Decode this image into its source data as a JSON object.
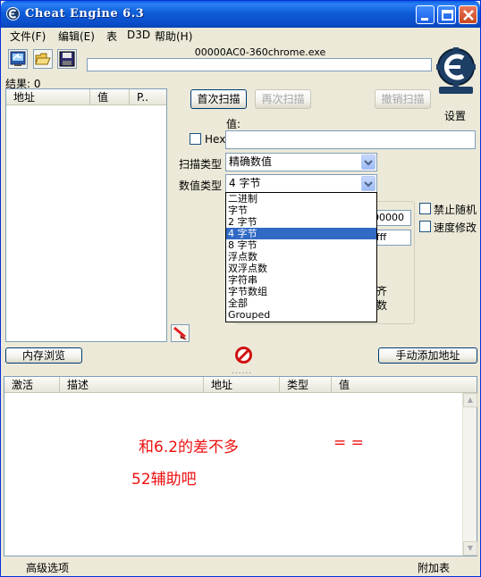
{
  "window": {
    "title": "Cheat Engine 6.3",
    "controls": [
      "minimize-icon",
      "maximize-icon",
      "close-icon"
    ]
  },
  "menu": [
    "文件(F)",
    "编辑(E)",
    "表",
    "D3D",
    "帮助(H)"
  ],
  "toolbar": {
    "icons": [
      "open-process-icon",
      "open-file-icon",
      "save-icon"
    ],
    "process_name": "00000AC0-360chrome.exe",
    "settings_label": "设置",
    "results_label": "结果: 0"
  },
  "address_list": {
    "columns": [
      "地址",
      "值",
      "P.."
    ]
  },
  "scan": {
    "first_scan": "首次扫描",
    "next_scan": "再次扫描",
    "undo_scan": "撤销扫描",
    "value_label": "值:",
    "hex_label": "Hex",
    "value_input": "",
    "scan_type_label": "扫描类型",
    "scan_type_value": "精确数值",
    "value_type_label": "数值类型",
    "value_type_value": "4 字节",
    "value_type_options": [
      "二进制",
      "字节",
      "2 字节",
      "4 字节",
      "8 字节",
      "浮点数",
      "双浮点数",
      "字符串",
      "字节数组",
      "全部",
      "Grouped"
    ],
    "value_type_selected_index": 3,
    "hidden_start": "00000",
    "hidden_stop": "ffff",
    "hidden_text1": "齐",
    "hidden_text2": "数",
    "no_random_label": "禁止随机",
    "speedhack_label": "速度修改"
  },
  "actions": {
    "memory_view": "内存浏览",
    "add_address": "手动添加地址"
  },
  "results_table": {
    "columns": [
      "激活",
      "描述",
      "地址",
      "类型",
      "值"
    ],
    "note_line1": "和6.2的差不多",
    "note_equals": "= =",
    "note_line2": "52辅助吧"
  },
  "status": {
    "advanced": "高级选项",
    "table_extras": "附加表"
  },
  "colors": {
    "titlebar": "#0b4fcb",
    "selection": "#316ac5",
    "note_text": "#ee1010",
    "window_bg": "#ece9d8"
  }
}
